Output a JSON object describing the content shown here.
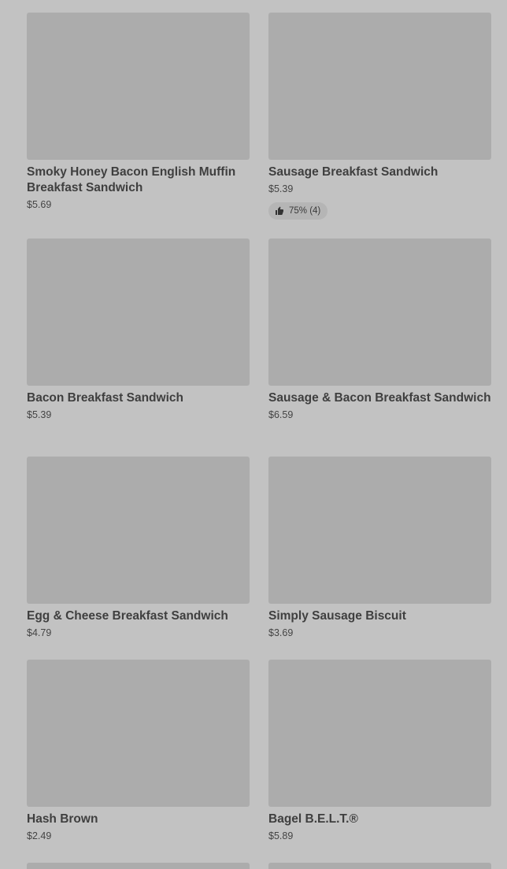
{
  "products": [
    {
      "name": "Smoky Honey Bacon English Muffin Breakfast Sandwich",
      "price": "$5.69"
    },
    {
      "name": "Sausage Breakfast Sandwich",
      "price": "$5.39",
      "rating": "75% (4)"
    },
    {
      "name": "Bacon Breakfast Sandwich",
      "price": "$5.39"
    },
    {
      "name": "Sausage & Bacon Breakfast Sandwich",
      "price": "$6.59"
    },
    {
      "name": "Egg & Cheese Breakfast Sandwich",
      "price": "$4.79"
    },
    {
      "name": "Simply Sausage Biscuit",
      "price": "$3.69"
    },
    {
      "name": "Hash Brown",
      "price": "$2.49"
    },
    {
      "name": "Bagel B.E.L.T.®",
      "price": "$5.89"
    }
  ],
  "icons": {
    "rating": "thumbs-up-icon"
  },
  "colors": {
    "background": "#c2c2c2",
    "image_placeholder": "#acacac",
    "text": "#3f3f3f"
  }
}
